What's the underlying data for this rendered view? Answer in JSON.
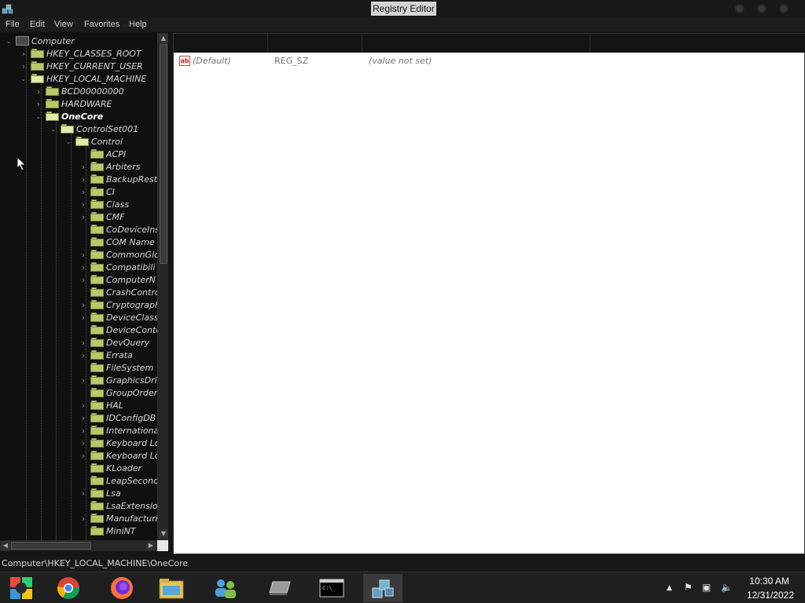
{
  "window": {
    "title": "Registry Editor"
  },
  "menu": [
    "File",
    "Edit",
    "View",
    "Favorites",
    "Help"
  ],
  "tree": [
    {
      "label": "Computer",
      "level": 0,
      "expanded": true,
      "type": "computer"
    },
    {
      "label": "HKEY_CLASSES_ROOT",
      "level": 1,
      "has_children": true
    },
    {
      "label": "HKEY_CURRENT_USER",
      "level": 1,
      "has_children": true
    },
    {
      "label": "HKEY_LOCAL_MACHINE",
      "level": 1,
      "expanded": true
    },
    {
      "label": "BCD00000000",
      "level": 2,
      "has_children": true
    },
    {
      "label": "HARDWARE",
      "level": 2,
      "has_children": true
    },
    {
      "label": "OneCore",
      "level": 2,
      "expanded": true,
      "selected": true
    },
    {
      "label": "ControlSet001",
      "level": 3,
      "expanded": true
    },
    {
      "label": "Control",
      "level": 4,
      "expanded": true
    },
    {
      "label": "ACPI",
      "level": 5,
      "has_children": false
    },
    {
      "label": "Arbiters",
      "level": 5,
      "has_children": true
    },
    {
      "label": "BackupResto",
      "level": 5,
      "has_children": true
    },
    {
      "label": "CI",
      "level": 5,
      "has_children": true
    },
    {
      "label": "Class",
      "level": 5,
      "has_children": true
    },
    {
      "label": "CMF",
      "level": 5,
      "has_children": true
    },
    {
      "label": "CoDeviceIns",
      "level": 5,
      "has_children": false
    },
    {
      "label": "COM Name",
      "level": 5,
      "has_children": false
    },
    {
      "label": "CommonGlo",
      "level": 5,
      "has_children": true
    },
    {
      "label": "Compatibili",
      "level": 5,
      "has_children": true
    },
    {
      "label": "ComputerN",
      "level": 5,
      "has_children": true
    },
    {
      "label": "CrashContro",
      "level": 5,
      "has_children": false
    },
    {
      "label": "Cryptograph",
      "level": 5,
      "has_children": true
    },
    {
      "label": "DeviceClass",
      "level": 5,
      "has_children": true
    },
    {
      "label": "DeviceConte",
      "level": 5,
      "has_children": false
    },
    {
      "label": "DevQuery",
      "level": 5,
      "has_children": true
    },
    {
      "label": "Errata",
      "level": 5,
      "has_children": true
    },
    {
      "label": "FileSystem",
      "level": 5,
      "has_children": false
    },
    {
      "label": "GraphicsDri",
      "level": 5,
      "has_children": true
    },
    {
      "label": "GroupOrder",
      "level": 5,
      "has_children": false
    },
    {
      "label": "HAL",
      "level": 5,
      "has_children": true
    },
    {
      "label": "IDConfigDB",
      "level": 5,
      "has_children": true
    },
    {
      "label": "Internationa",
      "level": 5,
      "has_children": true
    },
    {
      "label": "Keyboard Lo",
      "level": 5,
      "has_children": true
    },
    {
      "label": "Keyboard Lo",
      "level": 5,
      "has_children": true
    },
    {
      "label": "KLoader",
      "level": 5,
      "has_children": false
    },
    {
      "label": "LeapSecond",
      "level": 5,
      "has_children": false
    },
    {
      "label": "Lsa",
      "level": 5,
      "has_children": true
    },
    {
      "label": "LsaExtensio",
      "level": 5,
      "has_children": false
    },
    {
      "label": "Manufacturi",
      "level": 5,
      "has_children": true
    },
    {
      "label": "MiniNT",
      "level": 5,
      "has_children": false
    }
  ],
  "values": [
    {
      "name": "(Default)",
      "type": "REG_SZ",
      "data": "(value not set)",
      "icon": "ab-string-icon"
    }
  ],
  "status": {
    "path": "Computer\\HKEY_LOCAL_MACHINE\\OneCore"
  },
  "taskbar": {
    "apps": [
      {
        "name": "start-icon",
        "active": false
      },
      {
        "name": "chrome-icon",
        "active": false
      },
      {
        "name": "firefox-icon",
        "active": false
      },
      {
        "name": "file-explorer-icon",
        "active": false
      },
      {
        "name": "people-icon",
        "active": false
      },
      {
        "name": "drive-icon",
        "active": false
      },
      {
        "name": "terminal-icon",
        "active": false
      },
      {
        "name": "regedit-icon",
        "active": true
      }
    ],
    "tray": [
      "chevron-up-icon",
      "flag-icon",
      "network-icon",
      "volume-icon"
    ],
    "clock": {
      "time": "10:30 AM",
      "date": "12/31/2022"
    }
  },
  "colors": {
    "folder": "#b8c86a",
    "window_bg": "#101010",
    "value_bg": "#ffffff",
    "title_highlight": "#d4d4d4"
  }
}
